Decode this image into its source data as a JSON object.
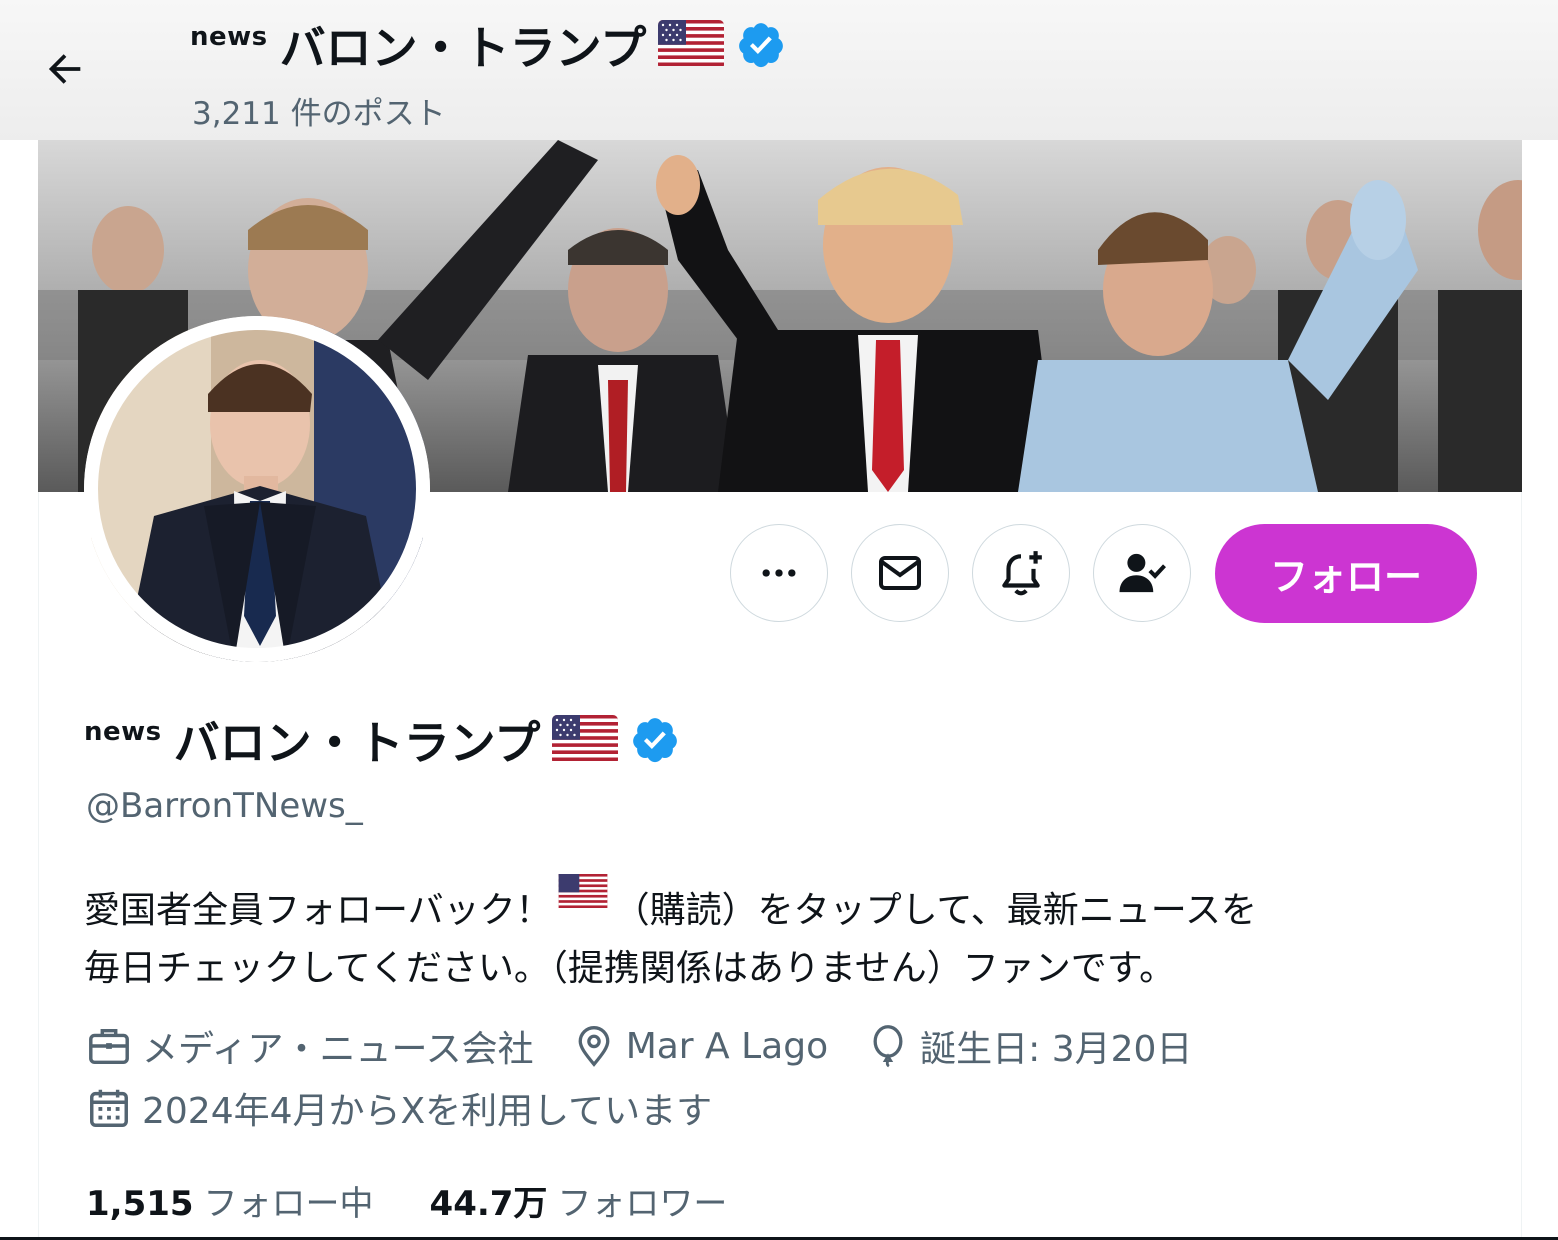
{
  "header": {
    "news_mark": "news",
    "display_name": "バロン・トランプ",
    "post_count": "3,211 件のポスト"
  },
  "actions": {
    "more": "more-button",
    "message": "message-button",
    "notify": "notification-button",
    "subscribe": "subscribe-button",
    "follow_label": "フォロー"
  },
  "profile": {
    "news_mark": "news",
    "display_name": "バロン・トランプ",
    "handle": "@BarronTNews_",
    "bio_line1_a": "愛国者全員フォローバック！",
    "bio_line1_b": "（購読）をタップして、最新ニュースを",
    "bio_line2": "毎日チェックしてください。（提携関係はありません）ファンです。",
    "category": "メディア・ニュース会社",
    "location": "Mar A Lago",
    "birthday": "誕生日: 3月20日",
    "joined": "2024年4月からXを利用しています"
  },
  "stats": {
    "following_count": "1,515",
    "following_label": "フォロー中",
    "followers_count": "44.7万",
    "followers_label": "フォロワー"
  },
  "colors": {
    "follow_button": "#cc35d2",
    "verified": "#1d9bf0",
    "secondary_text": "#536471"
  },
  "icons": [
    "back-arrow-icon",
    "us-flag-icon",
    "verified-badge-icon",
    "more-dots-icon",
    "envelope-icon",
    "bell-plus-icon",
    "person-check-icon",
    "briefcase-icon",
    "location-pin-icon",
    "balloon-icon",
    "calendar-icon"
  ]
}
